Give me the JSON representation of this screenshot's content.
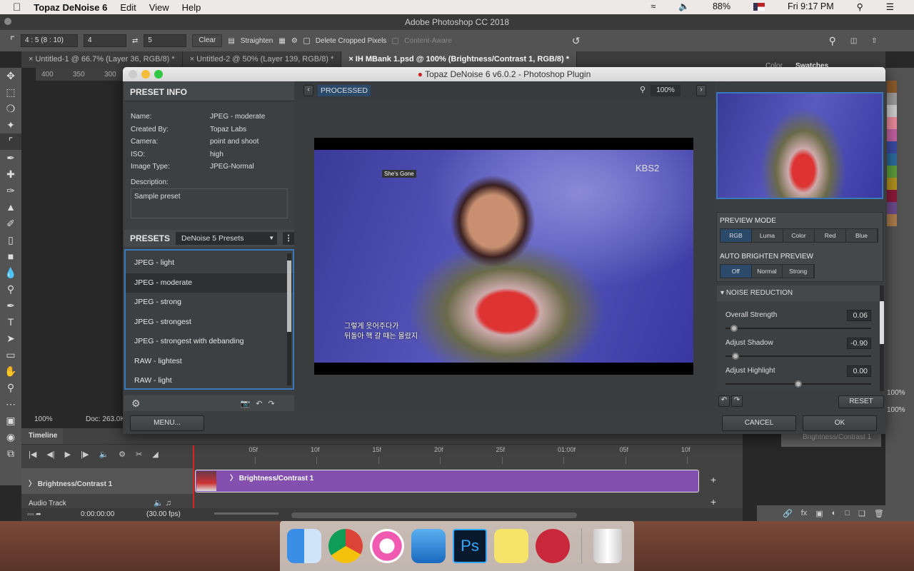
{
  "menubar": {
    "app": "Topaz DeNoise 6",
    "items": [
      "Edit",
      "View",
      "Help"
    ],
    "battery": "88%",
    "clock": "Fri 9:17 PM"
  },
  "ps": {
    "title": "Adobe Photoshop CC 2018",
    "options": {
      "ratio": "4 : 5 (8 : 10)",
      "w": "4",
      "h": "5",
      "clear": "Clear",
      "straighten": "Straighten",
      "delete_cropped": "Delete Cropped Pixels",
      "content_aware": "Content-Aware"
    },
    "tabs": [
      "Untitled-1 @ 66.7% (Layer 36, RGB/8) *",
      "Untitled-2 @ 50% (Layer 139, RGB/8) *",
      "IH MBank 1.psd @ 100% (Brightness/Contrast 1, RGB/8) *"
    ],
    "ruler": [
      "400",
      "350",
      "300"
    ],
    "status": {
      "zoom": "100%",
      "doc": "Doc: 263.0K"
    },
    "panel_tabs": [
      "Color",
      "Swatches"
    ],
    "layers_opacity": [
      "100%",
      "100%"
    ],
    "layer_name": "Brightness/Contrast 1"
  },
  "plugin": {
    "title": "Topaz DeNoise 6 v6.0.2 - Photoshop Plugin",
    "preset_info": {
      "header": "PRESET INFO",
      "rows": [
        {
          "k": "Name:",
          "v": "JPEG - moderate"
        },
        {
          "k": "Created By:",
          "v": "Topaz Labs"
        },
        {
          "k": "Camera:",
          "v": "point and shoot"
        },
        {
          "k": "ISO:",
          "v": "high"
        },
        {
          "k": "Image Type:",
          "v": "JPEG-Normal"
        }
      ],
      "desc_label": "Description:",
      "desc": "Sample preset"
    },
    "presets": {
      "header": "PRESETS",
      "dropdown": "DeNoise 5 Presets",
      "items": [
        "JPEG - light",
        "JPEG - moderate",
        "JPEG - strong",
        "JPEG - strongest",
        "JPEG - strongest with debanding",
        "RAW - lightest",
        "RAW - light"
      ],
      "selected": 1
    },
    "menu_button": "MENU...",
    "view": {
      "label": "PROCESSED",
      "zoom": "100%"
    },
    "image": {
      "channel": "KBS2",
      "song": "She's Gone",
      "subtitle1": "그렇게 웃어주다가",
      "subtitle2": "뒤돌아 핵 갈 때는 몰랐지"
    },
    "preview_mode": {
      "header": "PREVIEW MODE",
      "options": [
        "RGB",
        "Luma",
        "Color",
        "Red",
        "Blue"
      ],
      "selected": 0
    },
    "auto_brighten": {
      "header": "AUTO BRIGHTEN PREVIEW",
      "options": [
        "Off",
        "Normal",
        "Strong"
      ],
      "selected": 0
    },
    "noise": {
      "header": "NOISE REDUCTION",
      "sliders": [
        {
          "label": "Overall Strength",
          "value": "0.06",
          "pos": 0.06
        },
        {
          "label": "Adjust Shadow",
          "value": "-0.90",
          "pos": 0.07
        },
        {
          "label": "Adjust Highlight",
          "value": "0.00",
          "pos": 0.5
        }
      ]
    },
    "reset": "RESET",
    "cancel": "CANCEL",
    "ok": "OK"
  },
  "timeline": {
    "title": "Timeline",
    "ticks": [
      "05f",
      "10f",
      "15f",
      "20f",
      "25f",
      "01:00f",
      "05f",
      "10f"
    ],
    "track": "Brightness/Contrast 1",
    "clip": "Brightness/Contrast 1",
    "audio": "Audio Track",
    "time": "0:00:00:00",
    "fps": "(30.00 fps)",
    "clip_color": "#8450b0"
  },
  "colors": {
    "accent": "#2b4a6a",
    "swatches": [
      "#8b5a2b",
      "#999999",
      "#cccccc",
      "#e88a9a",
      "#c060a0",
      "#3a4aa0",
      "#2a6a9a",
      "#5a9a3a",
      "#b09020",
      "#8a1a3a",
      "#6a4a8a",
      "#aa7a4a"
    ]
  }
}
